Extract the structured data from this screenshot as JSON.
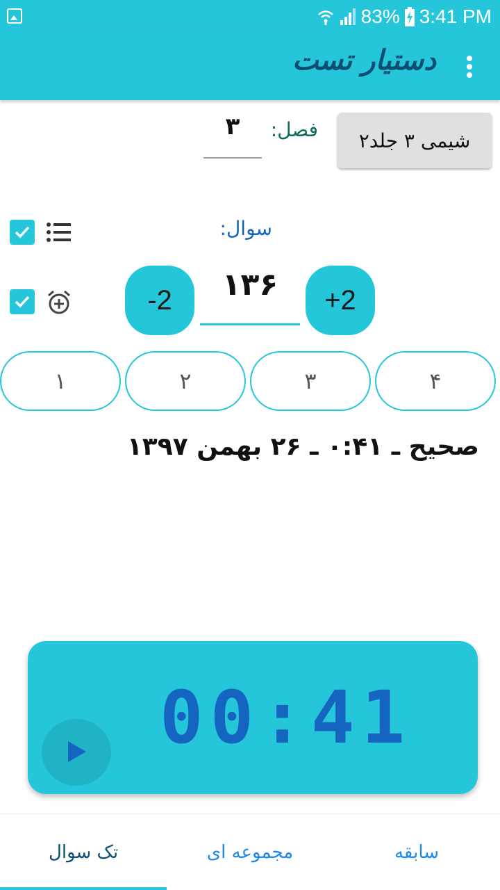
{
  "status_bar": {
    "battery": "83%",
    "time": "3:41 PM",
    "icons": [
      "gallery-icon",
      "wifi-icon",
      "signal-icon",
      "battery-charging-icon"
    ]
  },
  "app_bar": {
    "title": "دستیار تست",
    "menu_icon": "overflow-menu-icon"
  },
  "form": {
    "book_button": "شیمی ۳ جلد۲",
    "chapter_label": "فصل:",
    "chapter_value": "۳",
    "question_label": "سوال:",
    "question_value": "۱۳۶",
    "minus_label": "-2",
    "plus_label": "+2",
    "list_checkbox_checked": true,
    "alarm_checkbox_checked": true
  },
  "options": [
    "۱",
    "۲",
    "۳",
    "۴"
  ],
  "result": {
    "text": "صحیح ـ ۰:۴۱ ـ ۲۶ بهمن ۱۳۹۷"
  },
  "timer": {
    "display": "00:41",
    "play_icon": "play-icon"
  },
  "bottom_nav": {
    "tabs": [
      "تک سوال",
      "مجموعه ای",
      "سابقه"
    ],
    "active_tab": "تک سوال"
  },
  "colors": {
    "primary": "#26c6da",
    "title": "#0d4f73",
    "timer_digits": "#1565c0",
    "chapter_label": "#0d6b5a",
    "question_label": "#1565c0"
  }
}
